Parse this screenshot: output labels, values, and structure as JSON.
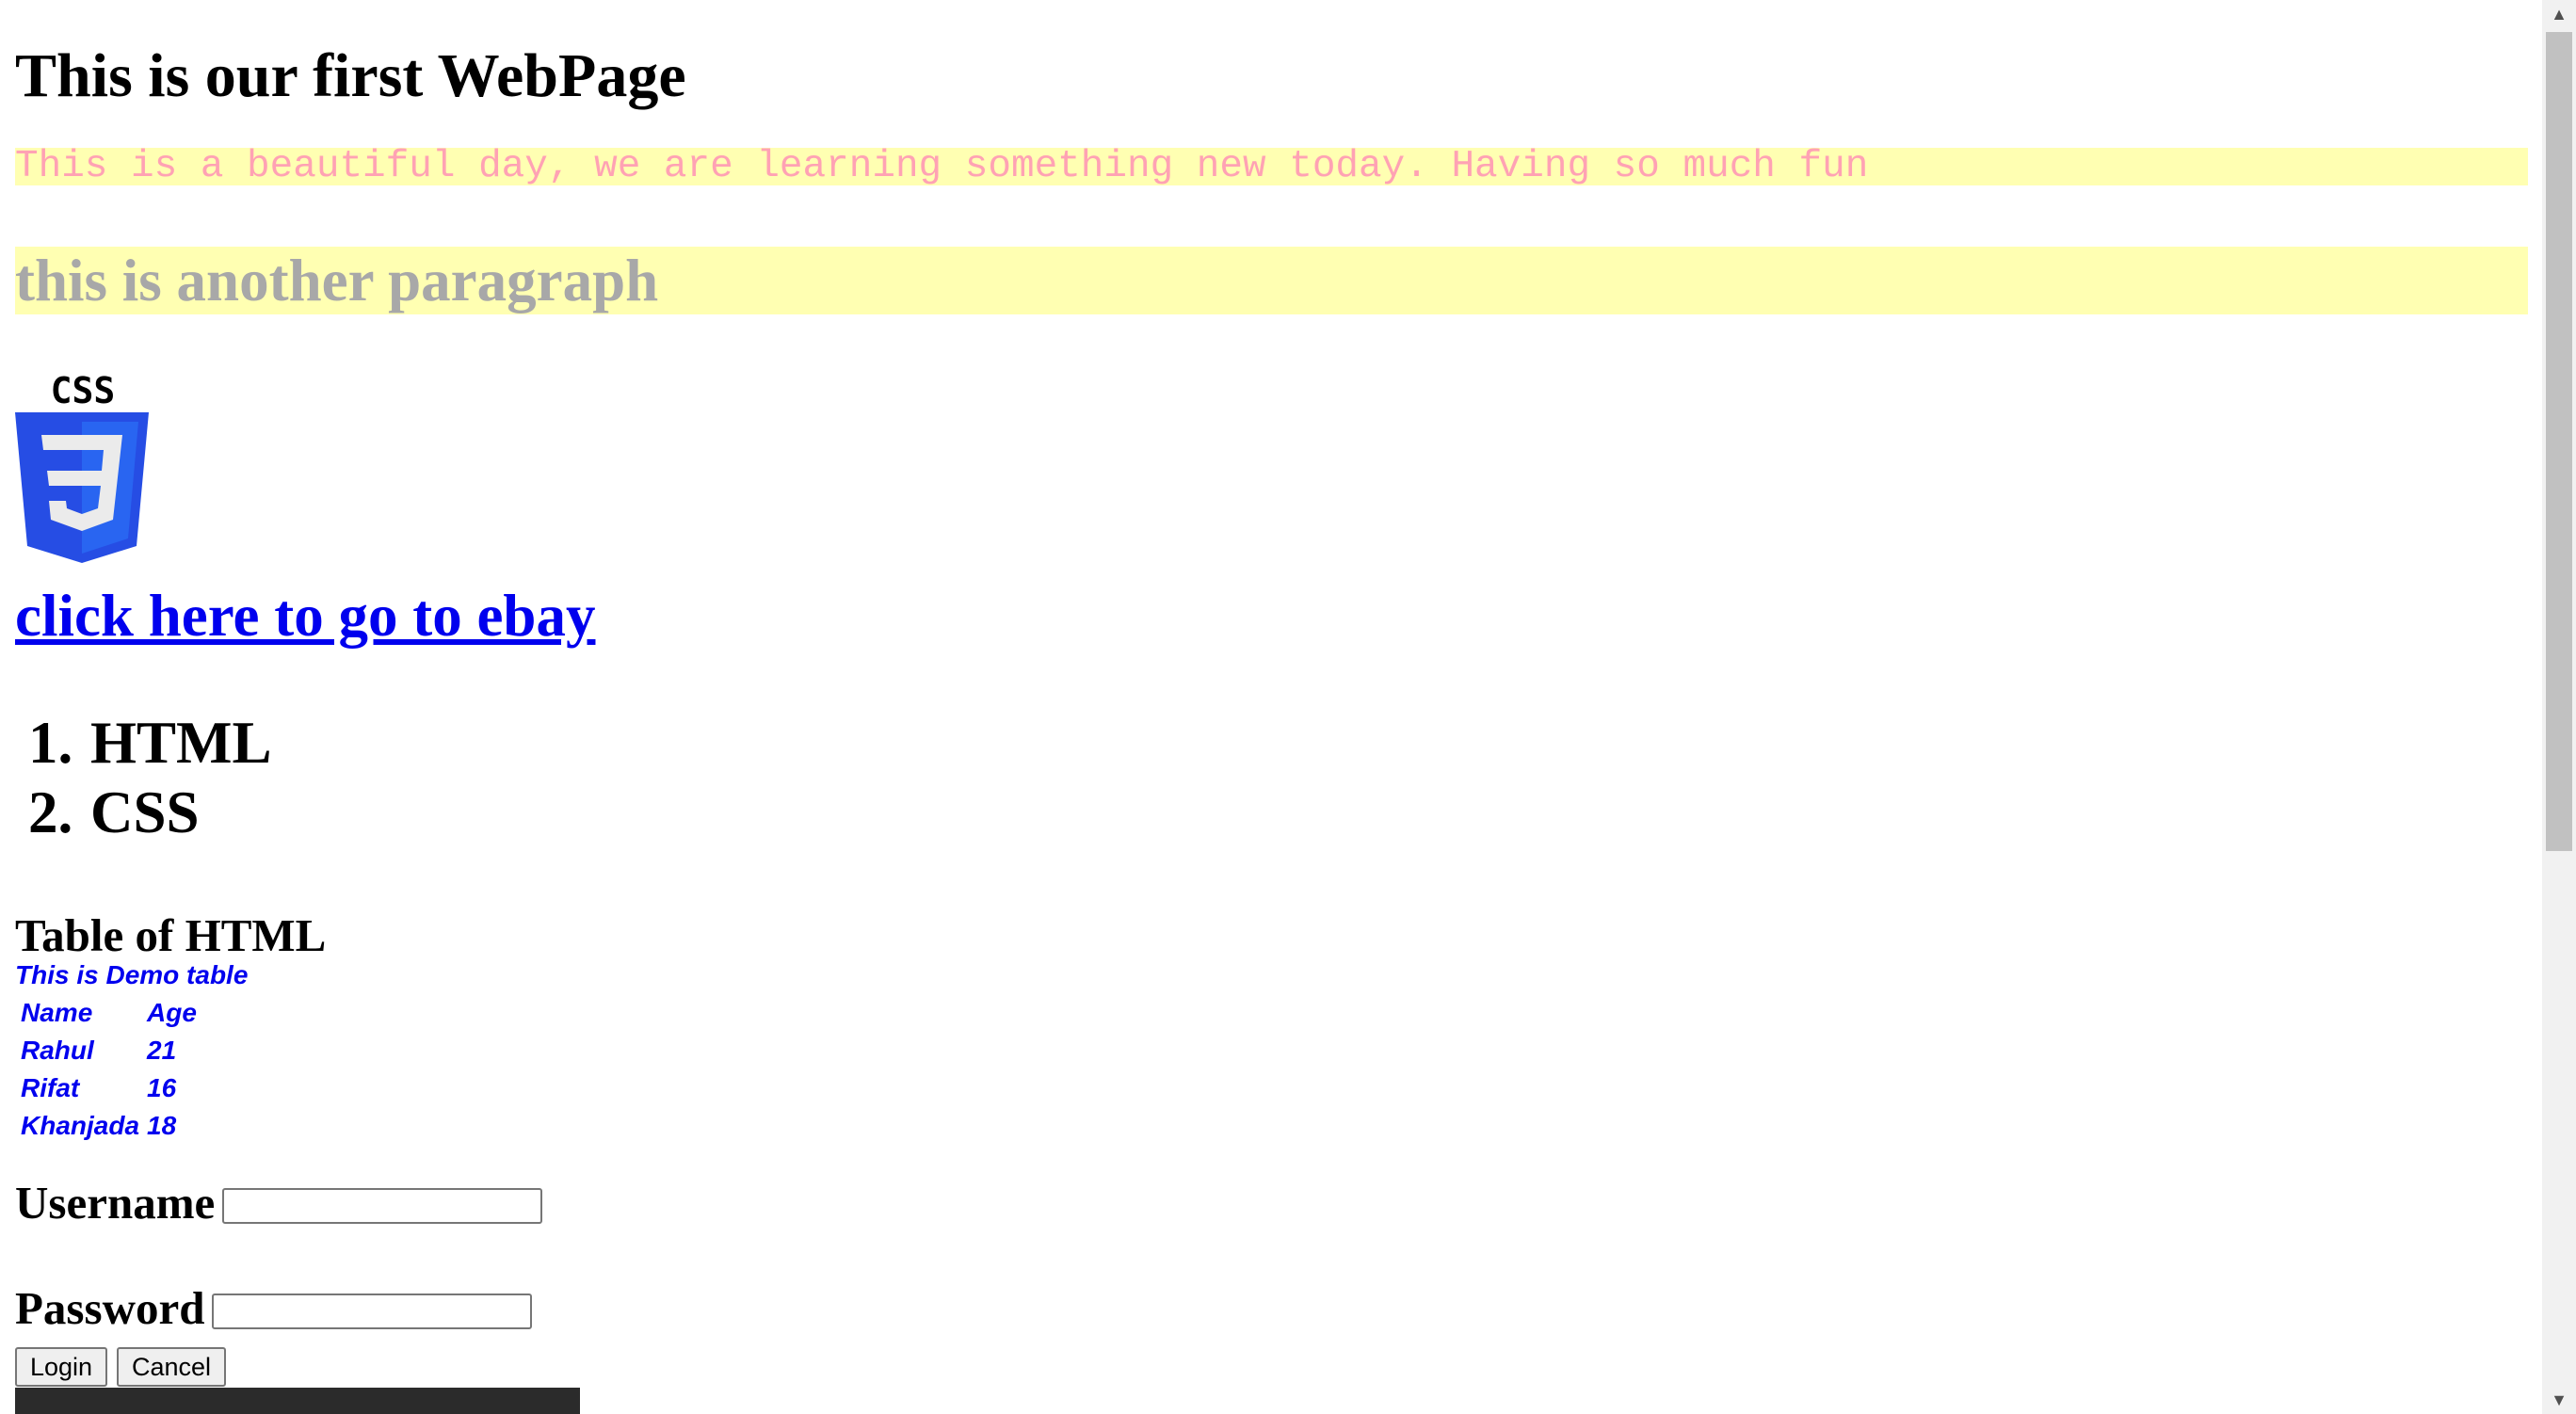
{
  "heading": "This is our first WebPage",
  "paragraphs": {
    "first": "This is a beautiful day, we are learning something new today. Having so much fun",
    "second": "this is another paragraph"
  },
  "logo": {
    "icon": "css3-logo-icon",
    "label": "CSS"
  },
  "link": {
    "text": "click here to go to ebay"
  },
  "ordered_list": [
    {
      "number": "1.",
      "label": "HTML"
    },
    {
      "number": "2.",
      "label": "CSS"
    }
  ],
  "table_section": {
    "title": "Table of HTML",
    "caption": "This is Demo table",
    "headers": [
      "Name",
      "Age"
    ],
    "rows": [
      [
        "Rahul",
        "21"
      ],
      [
        "Rifat",
        "16"
      ],
      [
        "Khanjada",
        "18"
      ]
    ]
  },
  "form": {
    "username_label": "Username",
    "username_value": "",
    "password_label": "Password",
    "password_value": "",
    "login_label": "Login",
    "cancel_label": "Cancel"
  },
  "colors": {
    "highlight_bg": "#ffffb2",
    "first_paragraph_text": "#ffa2b4",
    "second_paragraph_text": "#a8a8a8",
    "link": "#0000ee",
    "css_logo_blue": "#264de4"
  }
}
